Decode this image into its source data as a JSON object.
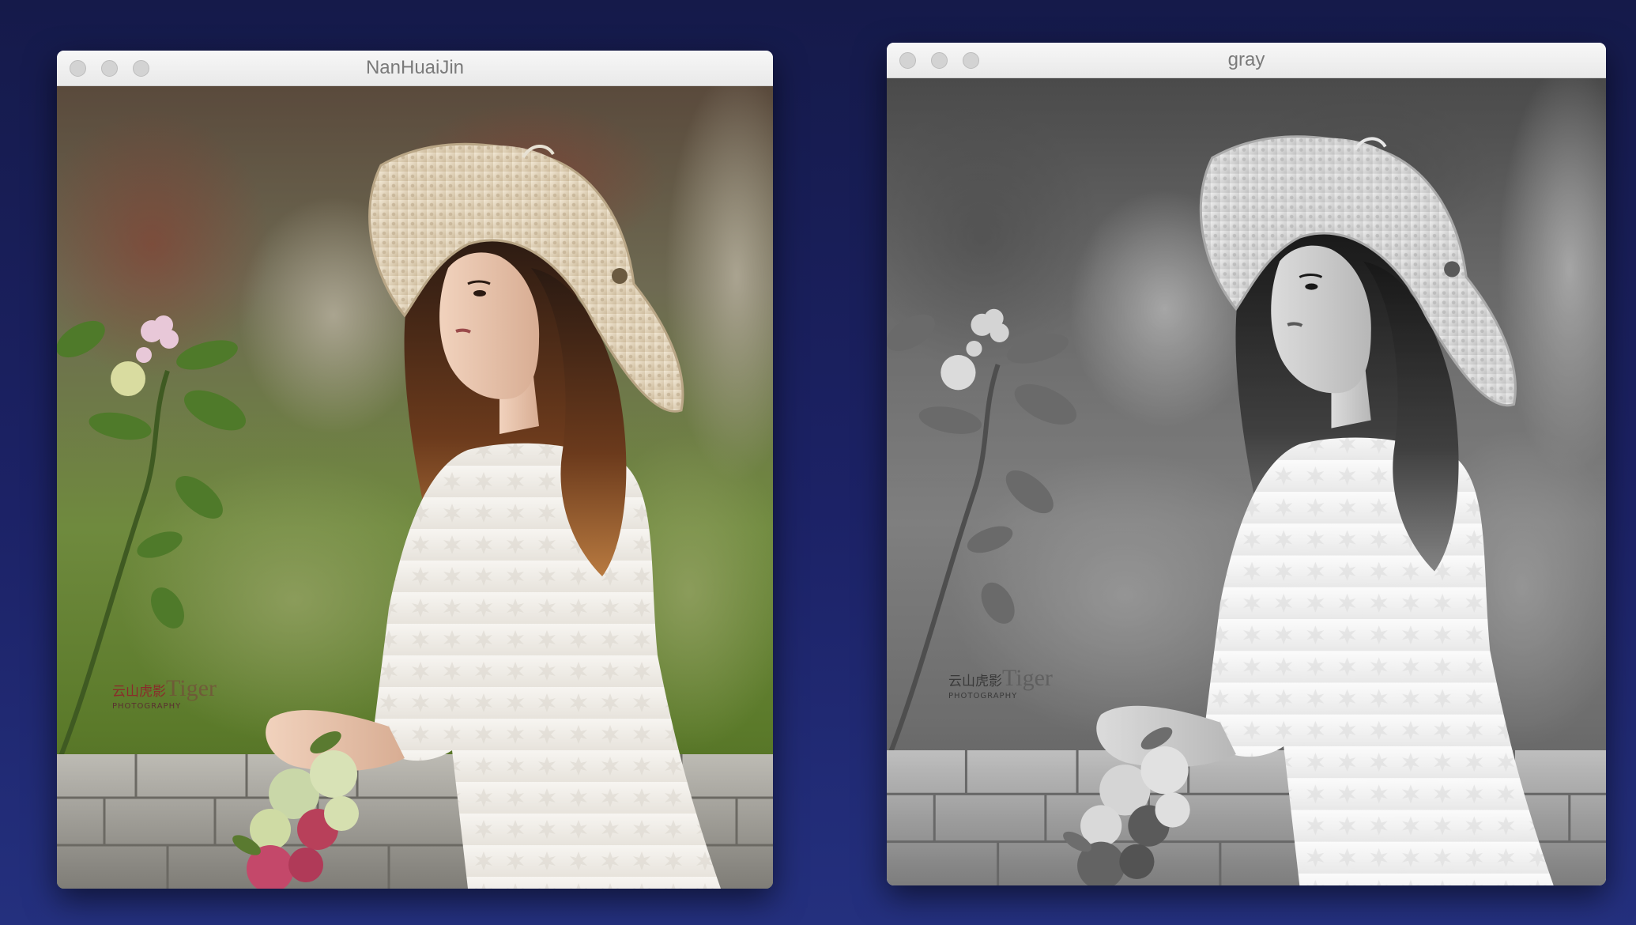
{
  "windows": [
    {
      "title": "NanHuaiJin",
      "image": "portrait photo of woman in straw hat and white lace dress holding flowers",
      "watermark": {
        "cn": "云山虎影",
        "en": "Tiger",
        "sub": "PHOTOGRAPHY"
      },
      "traffic_lights": [
        "close-icon",
        "minimize-icon",
        "zoom-icon"
      ]
    },
    {
      "title": "gray",
      "image": "grayscale version of the same portrait photo",
      "watermark": {
        "cn": "云山虎影",
        "en": "Tiger",
        "sub": "PHOTOGRAPHY"
      },
      "traffic_lights": [
        "close-icon",
        "minimize-icon",
        "zoom-icon"
      ]
    }
  ],
  "colors": {
    "background": "#1c2266",
    "titlebar": "#efefef",
    "title_text": "#7a7a7a"
  }
}
